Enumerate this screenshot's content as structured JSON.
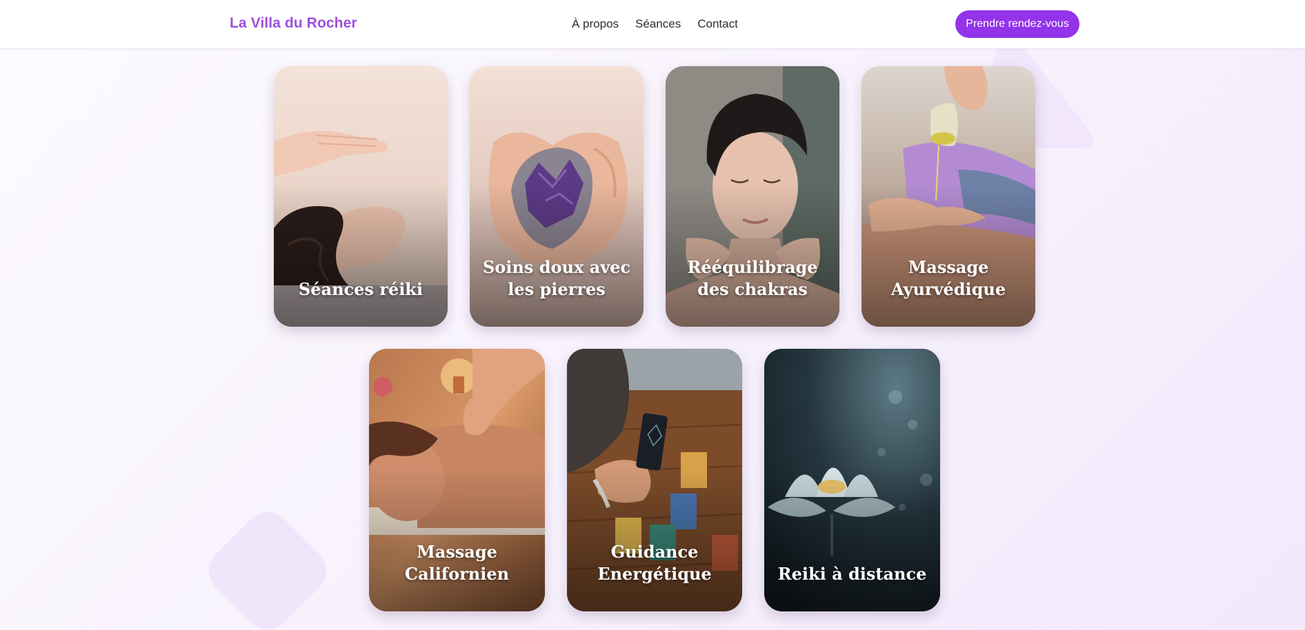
{
  "header": {
    "brand": "La Villa du Rocher",
    "nav": [
      {
        "label": "À propos"
      },
      {
        "label": "Séances"
      },
      {
        "label": "Contact"
      }
    ],
    "cta_label": "Prendre rendez-vous"
  },
  "colors": {
    "brand": "#9d4fe0",
    "cta": "#9333ea",
    "background": "#f8f3fd"
  },
  "cards": [
    {
      "title": "Séances réiki",
      "image": "reiki-hands-photo"
    },
    {
      "title": "Soins doux avec les pierres",
      "image": "amethyst-crystal-photo"
    },
    {
      "title": "Rééquilibrage des chakras",
      "image": "chakra-face-photo"
    },
    {
      "title": "Massage Ayurvédique",
      "image": "oil-pouring-photo"
    },
    {
      "title": "Massage Californien",
      "image": "back-massage-photo"
    },
    {
      "title": "Guidance Energétique",
      "image": "tarot-cards-photo"
    },
    {
      "title": "Reiki à distance",
      "image": "lotus-flower-photo"
    }
  ]
}
